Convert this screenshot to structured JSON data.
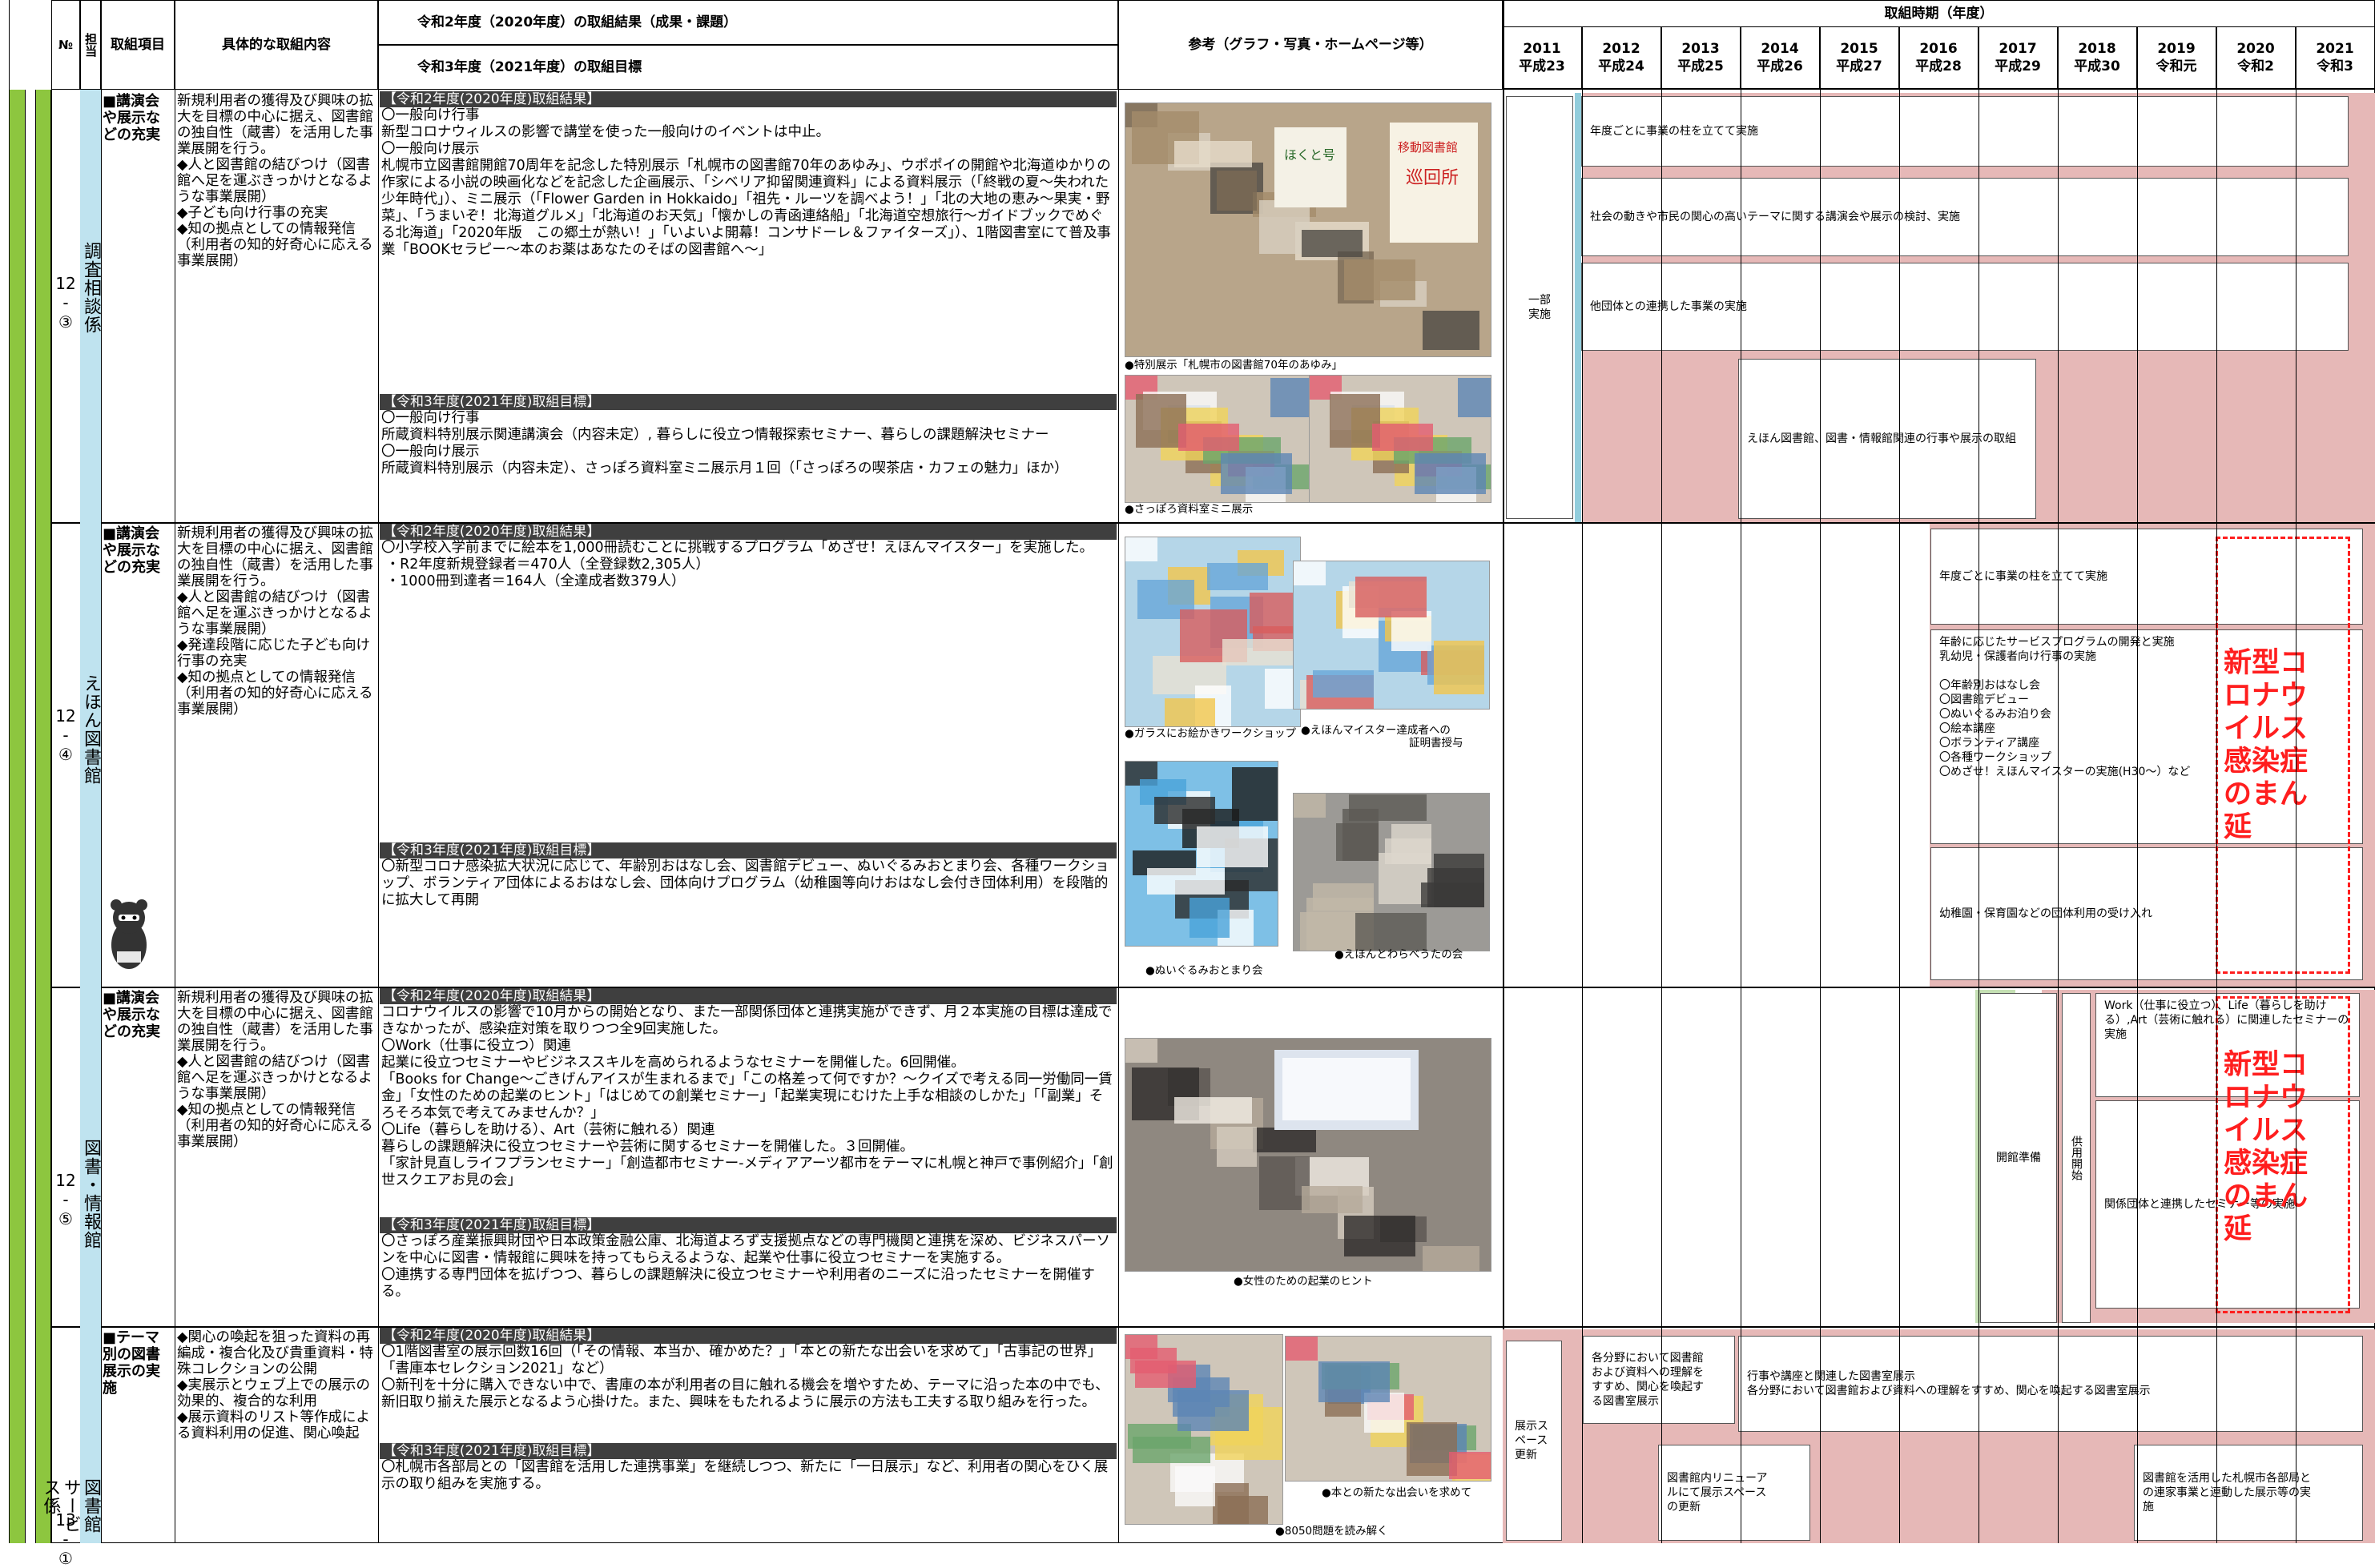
{
  "header": {
    "no": "№",
    "tanto": "担当",
    "item": "取組項目",
    "detail": "具体的な取組内容",
    "result_title": "令和2年度（2020年度）の取組結果（成果・課題）",
    "goal_title": "令和3年度（2021年度）の取組目標",
    "reference": "参考（グラフ・写真・ホームページ等）",
    "period": "取組時期（年度）",
    "years": [
      {
        "y": "2011",
        "w": "平成23"
      },
      {
        "y": "2012",
        "w": "平成24"
      },
      {
        "y": "2013",
        "w": "平成25"
      },
      {
        "y": "2014",
        "w": "平成26"
      },
      {
        "y": "2015",
        "w": "平成27"
      },
      {
        "y": "2016",
        "w": "平成28"
      },
      {
        "y": "2017",
        "w": "平成29"
      },
      {
        "y": "2018",
        "w": "平成30"
      },
      {
        "y": "2019",
        "w": "令和元"
      },
      {
        "y": "2020",
        "w": "令和2"
      },
      {
        "y": "2021",
        "w": "令和3"
      }
    ]
  },
  "rows": [
    {
      "no": "12\n-\n③",
      "tanto": "調査相談係",
      "item": "■講演会や展示などの充実",
      "detail": "新規利用者の獲得及び興味の拡大を目標の中心に据え、図書館の独自性（蔵書）を活用した事業展開を行う。\n◆人と図書館の結びつけ（図書館へ足を運ぶきっかけとなるような事業展開）\n◆子ども向け行事の充実\n◆知の拠点としての情報発信（利用者の知的好奇心に応える事業展開）",
      "result_label": "【令和2年度(2020年度)取組結果】",
      "result": "〇一般向け行事\n新型コロナウィルスの影響で講堂を使った一般向けのイベントは中止。\n〇一般向け展示\n札幌市立図書館開館70周年を記念した特別展示「札幌市の図書館70年のあゆみ」、ウポポイの開館や北海道ゆかりの作家による小説の映画化などを記念した企画展示、「シベリア抑留関連資料」による資料展示（「終戦の夏～失われた少年時代」）、ミニ展示（「Flower Garden in Hokkaido」「祖先・ルーツを調べよう！」「北の大地の恵み～果実・野菜」、「うまいぞ！北海道グルメ」「北海道のお天気」「懐かしの青函連絡船」「北海道空想旅行～ガイドブックでめぐる北海道」「2020年版　この郷土が熱い！」「いよいよ開幕！コンサドーレ＆ファイターズ」）、1階図書室にて普及事業「BOOKセラピー～本のお薬はあなたのそばの図書館へ～」",
      "goal_label": "【令和3年度(2021年度)取組目標】",
      "goal": "〇一般向け行事\n所蔵資料特別展示関連講演会（内容未定）, 暮らしに役立つ情報探索セミナー、暮らしの課題解決セミナー\n〇一般向け展示\n所蔵資料特別展示（内容未定）、さっぽろ資料室ミニ展示月１回（「さっぽろの喫茶店・カフェの魅力」ほか）",
      "captions": [
        "●特別展示「札幌市の図書館70年のあゆみ」",
        "●さっぽろ資料室ミニ展示"
      ],
      "photo_words": [
        "ほくと号",
        "移動図書館",
        "巡回所"
      ],
      "bars": [
        "年度ごとに事業の柱を立てて実施",
        "社会の動きや市民の関心の高いテーマに関する講演会や展示の検討、実施",
        "他団体との連携した事業の実施",
        "えほん図書館、図書・情報館関連の行事や展示の取組"
      ],
      "side": "一部\n実施"
    },
    {
      "no": "12\n-\n④",
      "tanto": "えほん図書館",
      "item": "■講演会や展示などの充実",
      "detail": "新規利用者の獲得及び興味の拡大を目標の中心に据え、図書館の独自性（蔵書）を活用した事業展開を行う。\n◆人と図書館の結びつけ（図書館へ足を運ぶきっかけとなるような事業展開）\n◆発達段階に応じた子ども向け行事の充実\n◆知の拠点としての情報発信（利用者の知的好奇心に応える事業展開）",
      "result_label": "【令和2年度(2020年度)取組結果】",
      "result": "〇小学校入学前までに絵本を1,000冊読むことに挑戦するプログラム「めざせ！えほんマイスター」を実施した。\n ・R2年度新規登録者＝470人（全登録数2,305人）\n ・1000冊到達者＝164人（全達成者数379人）",
      "goal_label": "【令和3年度(2021年度)取組目標】",
      "goal": "〇新型コロナ感染拡大状況に応じて、年齢別おはなし会、図書館デビュー、ぬいぐるみおとまり会、各種ワークショップ、ボランティア団体によるおはなし会、団体向けプログラム（幼稚園等向けおはなし会付き団体利用）を段階的に拡大して再開",
      "captions": [
        "●ガラスにお絵かきワークショップ",
        "●えほんマイスター達成者への\n　　　　　　　　　　証明書授与",
        "●ぬいぐるみおとまり会",
        "●えほんとわらべうたの会"
      ],
      "bars": [
        "年度ごとに事業の柱を立てて実施",
        "年齢に応じたサービスプログラムの開発と実施\n乳幼児・保護者向け行事の実施\n\n〇年齢別おはなし会\n〇図書館デビュー\n〇ぬいぐるみお泊り会\n〇絵本講座\n〇ボランティア講座\n〇各種ワークショップ\n〇めざせ！えほんマイスターの実施(H30～）など",
        "幼稚園・保育園などの団体利用の受け入れ"
      ],
      "covid": "新型コ\nロナウ\nイルス\n感染症\nのまん\n延"
    },
    {
      "no": "12\n-\n⑤",
      "tanto": "図書・情報館",
      "item": "■講演会や展示などの充実",
      "detail": "新規利用者の獲得及び興味の拡大を目標の中心に据え、図書館の独自性（蔵書）を活用した事業展開を行う。\n◆人と図書館の結びつけ（図書館へ足を運ぶきっかけとなるような事業展開）\n◆知の拠点としての情報発信（利用者の知的好奇心に応える事業展開）",
      "result_label": "【令和2年度(2020年度)取組結果】",
      "result": "コロナウイルスの影響で10月からの開始となり、また一部関係団体と連携実施ができず、月２本実施の目標は達成できなかったが、感染症対策を取りつつ全9回実施した。\n〇Work（仕事に役立つ）関連\n起業に役立つセミナーやビジネススキルを高められるようなセミナーを開催した。6回開催。\n「Books for Change～ごきげんアイスが生まれるまで」「この格差って何ですか？～クイズで考える同一労働同一賃金」「女性のための起業のヒント」「はじめての創業セミナー」「起業実現にむけた上手な相談のしかた」「「副業」そろそろ本気で考えてみませんか？」\n〇Life（暮らしを助ける）、Art（芸術に触れる）関連\n暮らしの課題解決に役立つセミナーや芸術に関するセミナーを開催した。３回開催。\n「家計見直しライフプランセミナー」「創造都市セミナー-メディアアーツ都市をテーマに札幌と神戸で事例紹介」「創世スクエアお見の会」",
      "goal_label": "【令和3年度(2021年度)取組目標】",
      "goal": "〇さっぽろ産業振興財団や日本政策金融公庫、北海道よろず支援拠点などの専門機関と連携を深め、ビジネスパーソンを中心に図書・情報館に興味を持ってもらえるような、起業や仕事に役立つセミナーを実施する。\n〇連携する専門団体を拡げつつ、暮らしの課題解決に役立つセミナーや利用者のニーズに沿ったセミナーを開催する。",
      "captions": [
        "●女性のための起業のヒント"
      ],
      "bars": [
        "開館準備",
        "供用開始",
        "Work（仕事に役立つ）、Life（暮らしを助ける）,Art（芸術に触れる）に関連したセミナーの実施",
        "関係団体と連携したセミナー等の実施"
      ],
      "covid": "新型コ\nロナウ\nイルス\n感染症\nのまん\n延"
    },
    {
      "no": "13\n-\n①",
      "tanto": "図書館サービス係",
      "item": "■テーマ別の図書展示の実施",
      "detail": "◆関心の喚起を狙った資料の再編成・複合化及び貴重資料・特殊コレクションの公開\n◆実展示とウェブ上での展示の効果的、複合的な利用\n◆展示資料のリスト等作成による資料利用の促進、関心喚起",
      "result_label": "【令和2年度(2020年度)取組結果】",
      "result": "〇1階図書室の展示回数16回（「その情報、本当か、確かめた？」「本との新たな出会いを求めて」「古事記の世界」「書庫本セレクション2021」など）\n〇新刊を十分に購入できない中で、書庫の本が利用者の目に触れる機会を増やすため、テーマに沿った本の中でも、新旧取り揃えた展示となるよう心掛けた。また、興味をもたれるように展示の方法も工夫する取り組みを行った。",
      "goal_label": "【令和3年度(2021年度)取組目標】",
      "goal": "〇札幌市各部局との「図書館を活用した連携事業」を継続しつつ、新たに「一日展示」など、利用者の関心をひく展示の取り組みを実施する。",
      "captions": [
        "●本との新たな出会いを求めて",
        "●8050問題を読み解く"
      ],
      "bars": [
        "展示ス\nペース\n更新",
        "各分野において図書館\nおよび資料への理解を\nすすめ、関心を喚起す\nる図書室展示",
        "行事や講座と関連した図書室展示\n各分野において図書館および資料への理解をすすめ、関心を喚起する図書室展示",
        "図書館内リニューア\nルにて展示スペース\nの更新",
        "図書館を活用した札幌市各部局と\nの連家事業と連動した展示等の実\n施"
      ]
    }
  ]
}
